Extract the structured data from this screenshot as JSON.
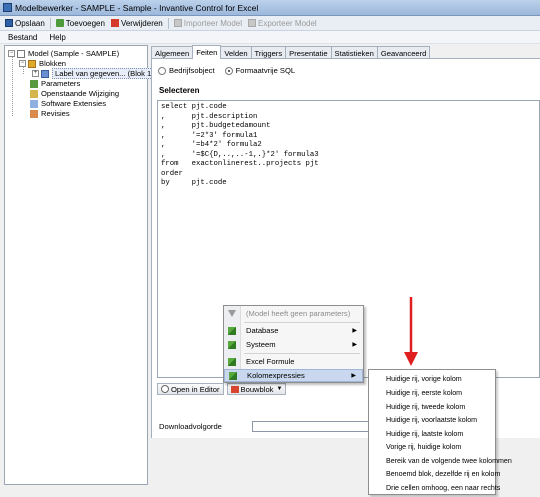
{
  "window": {
    "title": "Modelbewerker - SAMPLE - Sample - Invantive Control for Excel"
  },
  "toolbar": {
    "save": "Opslaan",
    "add": "Toevoegen",
    "delete": "Verwijderen",
    "import": "Importeer Model",
    "export": "Exporteer Model"
  },
  "menu": {
    "file": "Bestand",
    "help": "Help"
  },
  "tree": {
    "root": "Model (Sample - SAMPLE)",
    "blocks": "Blokken",
    "label_item": "Label van gegeven... (Blok 1)",
    "parameters": "Parameters",
    "pending": "Openstaande Wijziging",
    "extensions": "Software Extensies",
    "revisions": "Revisies"
  },
  "tabs": [
    "Algemeen",
    "Feiten",
    "Velden",
    "Triggers",
    "Presentatie",
    "Statistieken",
    "Geavanceerd"
  ],
  "active_tab": "Feiten",
  "radios": {
    "business_object": "Bedrijfsobject",
    "free_sql": "Formaatvrije SQL"
  },
  "section": {
    "select_heading": "Selecteren"
  },
  "sql": {
    "text": "select pjt.code\n,      pjt.description\n,      pjt.budgetedamount\n,      '=2*3' formula1\n,      '=b4*2' formula2\n,      '=$C{D,..,..-1,.}*2' formula3\nfrom   exactonlinerest..projects pjt\norder\nby     pjt.code"
  },
  "bottom": {
    "open_in_editor": "Open in Editor",
    "bouwblok": "Bouwblok",
    "download_order": "Downloadvolgorde"
  },
  "context_menu": {
    "no_params": "(Model heeft geen parameters)",
    "database": "Database",
    "system": "Systeem",
    "excel_formula": "Excel Formule",
    "column_expressions": "Kolomexpressies"
  },
  "submenu": {
    "items": [
      "Huidige rij, vorige kolom",
      "Huidige rij, eerste kolom",
      "Huidige rij, tweede kolom",
      "Huidige rij, voorlaatste kolom",
      "Huidige rij, laatste kolom",
      "Vorige rij, huidige kolom",
      "Bereik van de volgende twee kolommen",
      "Benoemd blok, dezelfde rij en kolom",
      "Drie cellen omhoog, een naar rechts"
    ]
  },
  "colors": {
    "annotation_arrow": "#e02020",
    "highlight": "#c9d8ee"
  }
}
